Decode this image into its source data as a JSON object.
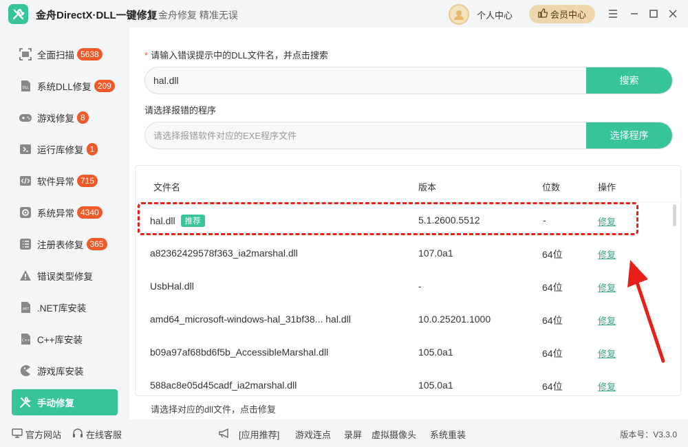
{
  "app": {
    "title": "金舟DirectX·DLL一键修复",
    "slogan": "金舟修复 精准无误",
    "user_center": "个人中心",
    "vip_label": "会员中心"
  },
  "sidebar": {
    "items": [
      {
        "label": "全面扫描",
        "badge": "5638",
        "icon": "scan-icon"
      },
      {
        "label": "系统DLL修复",
        "badge": "209",
        "icon": "dll-icon"
      },
      {
        "label": "游戏修复",
        "badge": "8",
        "icon": "gamepad-icon"
      },
      {
        "label": "运行库修复",
        "badge": "1",
        "icon": "runtime-icon"
      },
      {
        "label": "软件异常",
        "badge": "715",
        "icon": "code-icon"
      },
      {
        "label": "系统异常",
        "badge": "4340",
        "icon": "gear-icon"
      },
      {
        "label": "注册表修复",
        "badge": "365",
        "icon": "list-icon"
      },
      {
        "label": "错误类型修复",
        "badge": "",
        "icon": "warning-icon"
      },
      {
        "label": ".NET库安装",
        "badge": "",
        "icon": "dotnet-icon"
      },
      {
        "label": "C++库安装",
        "badge": "",
        "icon": "cpp-icon"
      },
      {
        "label": "游戏库安装",
        "badge": "",
        "icon": "pacman-icon"
      },
      {
        "label": "手动修复",
        "badge": "",
        "icon": "wrench-icon",
        "active": true
      }
    ]
  },
  "main": {
    "dll_label": "请输入错误提示中的DLL文件名，并点击搜索",
    "dll_input_value": "hal.dll",
    "search_button": "搜索",
    "program_label": "请选择报错的程序",
    "program_placeholder": "请选择报错软件对应的EXE程序文件",
    "select_program_button": "选择程序",
    "hint": "请选择对应的dll文件，点击修复"
  },
  "table": {
    "columns": [
      "文件名",
      "版本",
      "位数",
      "操作"
    ],
    "rows": [
      {
        "name": "hal.dll",
        "tag": "推荐",
        "version": "5.1.2600.5512",
        "bits": "-",
        "action": "修复"
      },
      {
        "name": "a82362429578f363_ia2marshal.dll",
        "tag": "",
        "version": "107.0a1",
        "bits": "64位",
        "action": "修复"
      },
      {
        "name": "UsbHal.dll",
        "tag": "",
        "version": "-",
        "bits": "64位",
        "action": "修复"
      },
      {
        "name": "amd64_microsoft-windows-hal_31bf38... hal.dll",
        "tag": "",
        "version": "10.0.25201.1000",
        "bits": "64位",
        "action": "修复"
      },
      {
        "name": "b09a97af68bd6f5b_AccessibleMarshal.dll",
        "tag": "",
        "version": "105.0a1",
        "bits": "64位",
        "action": "修复"
      },
      {
        "name": "588ac8e05d45cadf_ia2marshal.dll",
        "tag": "",
        "version": "105.0a1",
        "bits": "64位",
        "action": "修复"
      }
    ]
  },
  "footer": {
    "website": "官方网站",
    "support": "在线客服",
    "recommend": "[应用推荐]",
    "links": [
      "游戏连点",
      "录屏",
      "虚拟摄像头",
      "系统重装"
    ],
    "version": "版本号：V3.3.0"
  },
  "colors": {
    "accent": "#38c49a",
    "badge": "#f05a28",
    "highlight": "#e8201a",
    "vip": "#efd7ad"
  }
}
